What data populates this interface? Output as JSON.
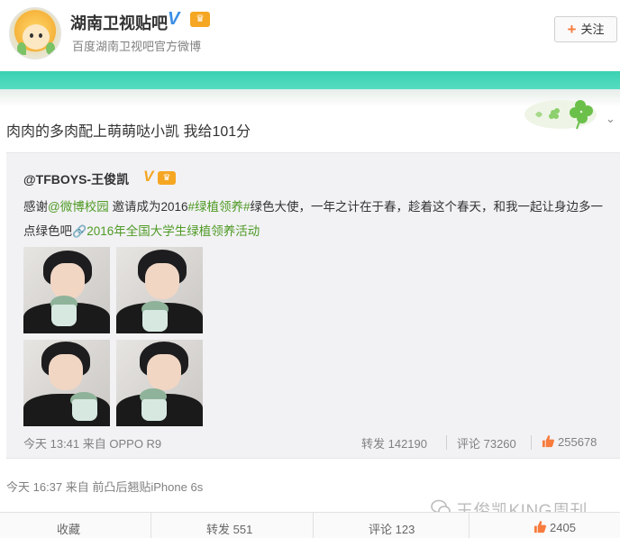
{
  "header": {
    "account_name": "湖南卫视贴吧",
    "description": "百度湖南卫视吧官方微博",
    "follow_label": "关注",
    "verified_icon": "blue-v-icon",
    "vip_icon": "vip-badge-icon"
  },
  "post": {
    "text": "肉肉的多肉配上萌萌哒小凯 我给101分",
    "meta": "今天 16:37 来自 前凸后翘贴iPhone 6s"
  },
  "repost": {
    "author": "@TFBOYS-王俊凯",
    "text_prefix": "感谢",
    "mention": "@微博校园",
    "text_mid": " 邀请成为2016",
    "hashtag": "#绿植领养#",
    "text_suffix": "绿色大使，一年之计在于春，趁着这个春天，和我一起让身边多一点绿色吧",
    "link": "2016年全国大学生绿植领养活动",
    "images": [
      "photo-1",
      "photo-2",
      "photo-3",
      "photo-4"
    ],
    "meta": "今天 13:41 来自 OPPO R9",
    "repost_label": "转发 142190",
    "comment_label": "评论 73260",
    "like_count": "255678"
  },
  "actions": {
    "favorite": "收藏",
    "repost": "转发 551",
    "comment": "评论 123",
    "like": "2405"
  },
  "watermark": "王俊凯KING周刊",
  "colors": {
    "accent_band": "#3bd1b2",
    "link_green": "#4f9a24",
    "verified_blue": "#3a8ee6",
    "vip_orange": "#f5a623",
    "like_orange": "#f77c3d"
  }
}
